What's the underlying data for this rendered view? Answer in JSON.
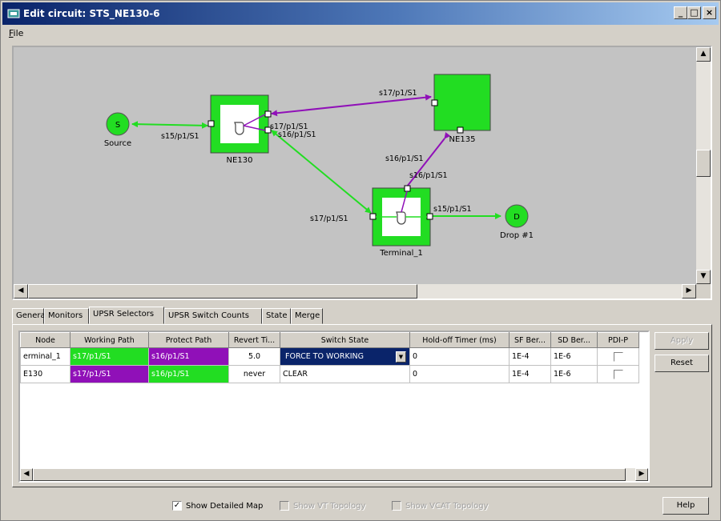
{
  "window": {
    "title": "Edit circuit: STS_NE130-6"
  },
  "menu": {
    "file_mnemonic": "F",
    "file_rest": "ile"
  },
  "map": {
    "nodes": {
      "source": {
        "letter": "S",
        "label": "Source"
      },
      "ne130": {
        "label": "NE130"
      },
      "ne135": {
        "label": "NE135"
      },
      "terminal": {
        "label": "Terminal_1"
      },
      "drop": {
        "letter": "D",
        "label": "Drop #1"
      }
    },
    "links": {
      "src_ne130": "s15/p1/S1",
      "ne130_a": "s17/p1/S1",
      "ne130_b": "s16/p1/S1",
      "ne135_top": "s17/p1/S1",
      "ne135_down": "s16/p1/S1",
      "term_up": "s16/p1/S1",
      "term_left": "s17/p1/S1",
      "term_drop": "s15/p1/S1"
    },
    "colors": {
      "working": "#22dd22",
      "protect": "#9010b8",
      "background": "#c3c3c3"
    }
  },
  "tabs": [
    "General",
    "Monitors",
    "UPSR Selectors",
    "UPSR Switch Counts",
    "State",
    "Merge"
  ],
  "active_tab": "UPSR Selectors",
  "table": {
    "headers": [
      "Node",
      "Working Path",
      "Protect Path",
      "Revert Ti...",
      "Switch State",
      "Hold-off Timer (ms)",
      "SF Ber...",
      "SD Ber...",
      "PDI-P"
    ],
    "rows": [
      {
        "node": "erminal_1",
        "working": "s17/p1/S1",
        "protect": "s16/p1/S1",
        "revert": "5.0",
        "switch_state": "FORCE TO WORKING",
        "holdoff": "0",
        "sf": "1E-4",
        "sd": "1E-6"
      },
      {
        "node": "E130",
        "working": "s17/p1/S1",
        "protect": "s16/p1/S1",
        "revert": "never",
        "switch_state": "CLEAR",
        "holdoff": "0",
        "sf": "1E-4",
        "sd": "1E-6"
      }
    ]
  },
  "buttons": {
    "apply": "Apply",
    "reset": "Reset",
    "help": "Help"
  },
  "options": {
    "show_detailed_map": "Show Detailed Map",
    "show_vt_topology": "Show VT Topology",
    "show_vcat_topology": "Show VCAT Topology"
  }
}
